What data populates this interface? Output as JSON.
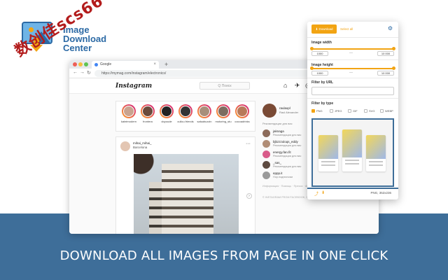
{
  "logo": {
    "line1": "Image",
    "line2": "Download",
    "line3": "Center",
    "watermark": "数创佳scs66"
  },
  "tagline": "DOWNLOAD ALL IMAGES FROM PAGE IN ONE CLICK",
  "browser": {
    "tab_title": "Google",
    "new_tab": "+",
    "url": "https://mymag.com/instagram/electronics/"
  },
  "instagram": {
    "logo": "Instagram",
    "search_placeholder": "Q Поиск",
    "stories": [
      "kateimodern",
      "frontera",
      "doyoude",
      "cullcu.friends",
      "salsabuzzin",
      "motoring_stu",
      "cocoadrinks"
    ],
    "post_user": "mihai_mihai_",
    "post_place": "Barcelona",
    "me_name": "raulaxpl",
    "me_sub": "Raul Alexander",
    "suggestions_title": "Рекомендации для вас",
    "suggestions": [
      {
        "name": "jaknaga",
        "sub": "Рекомендации для вас"
      },
      {
        "name": "bjbzzzuloqs_eddy",
        "sub": "Рекомендации для вас"
      },
      {
        "name": "energy.fan.fit",
        "sub": "Рекомендации для вас"
      },
      {
        "name": "_sas_",
        "sub": "Рекомендации для вас"
      },
      {
        "name": "eppp.it",
        "sub": "Нор.подписчики"
      }
    ],
    "footer1": "Информация · Помощь · Пресса · API · Вакансии",
    "footer2": "© INSTAGRAM FROM FACEBOOK, 2020"
  },
  "extension": {
    "download_btn": "Download",
    "select_all": "Select all",
    "image_width_label": "Image width",
    "width_min": "1000",
    "width_max": "10 000",
    "image_height_label": "Image height",
    "height_min": "1000",
    "height_max": "10 000",
    "dash": "—",
    "filter_url_label": "Filter by URL",
    "filter_type_label": "Filter by type",
    "types": [
      {
        "label": "PNG",
        "checked": true
      },
      {
        "label": "JPEG",
        "checked": false
      },
      {
        "label": "GIF",
        "checked": false
      },
      {
        "label": "SVG",
        "checked": false
      },
      {
        "label": "WEBP",
        "checked": false
      }
    ],
    "image_info": "PNG, 352x236",
    "accent": "#f2a413",
    "brand": "#3e6e99"
  }
}
